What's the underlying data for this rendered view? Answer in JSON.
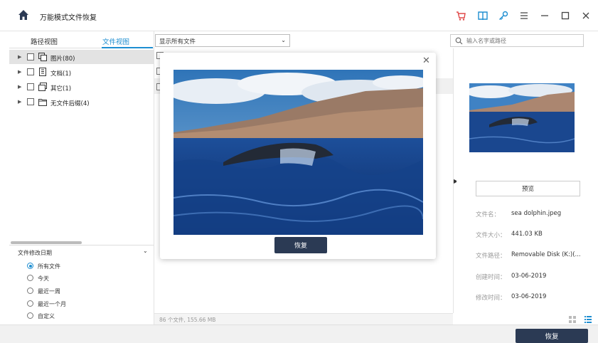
{
  "app": {
    "title": "万能模式文件恢复"
  },
  "toolbar": {
    "icons": [
      "cart-icon",
      "book-icon",
      "key-icon",
      "menu-icon",
      "minimize-icon",
      "maximize-icon",
      "close-icon"
    ]
  },
  "tabs": [
    {
      "label": "路径视图"
    },
    {
      "label": "文件视图"
    }
  ],
  "filter": {
    "selected": "显示所有文件"
  },
  "search": {
    "placeholder": "输入名字或路径"
  },
  "tree": [
    {
      "label": "图片(80)",
      "icon": "image-icon"
    },
    {
      "label": "文档(1)",
      "icon": "document-icon"
    },
    {
      "label": "其它(1)",
      "icon": "other-files-icon"
    },
    {
      "label": "无文件后缀(4)",
      "icon": "folder-icon"
    }
  ],
  "date_filter": {
    "title": "文件修改日期",
    "options": [
      "所有文件",
      "今天",
      "最近一周",
      "最近一个月",
      "自定义"
    ],
    "selected": "所有文件"
  },
  "status": {
    "summary": "86 个文件, 155.66 MB"
  },
  "popup": {
    "recover_label": "恢复"
  },
  "details": {
    "preview_label": "预览",
    "fields": [
      {
        "key": "文件名：",
        "value": "sea dolphin.jpeg"
      },
      {
        "key": "文件大小：",
        "value": "441.03  KB"
      },
      {
        "key": "文件路径：",
        "value": "Removable Disk (K:)(..."
      },
      {
        "key": "创建时间：",
        "value": "03-06-2019"
      },
      {
        "key": "修改时间：",
        "value": "03-06-2019"
      }
    ]
  },
  "footer": {
    "recover_label": "恢复"
  },
  "colors": {
    "accent": "#1e8ed1",
    "button": "#2b3a54",
    "cart": "#e04848"
  }
}
